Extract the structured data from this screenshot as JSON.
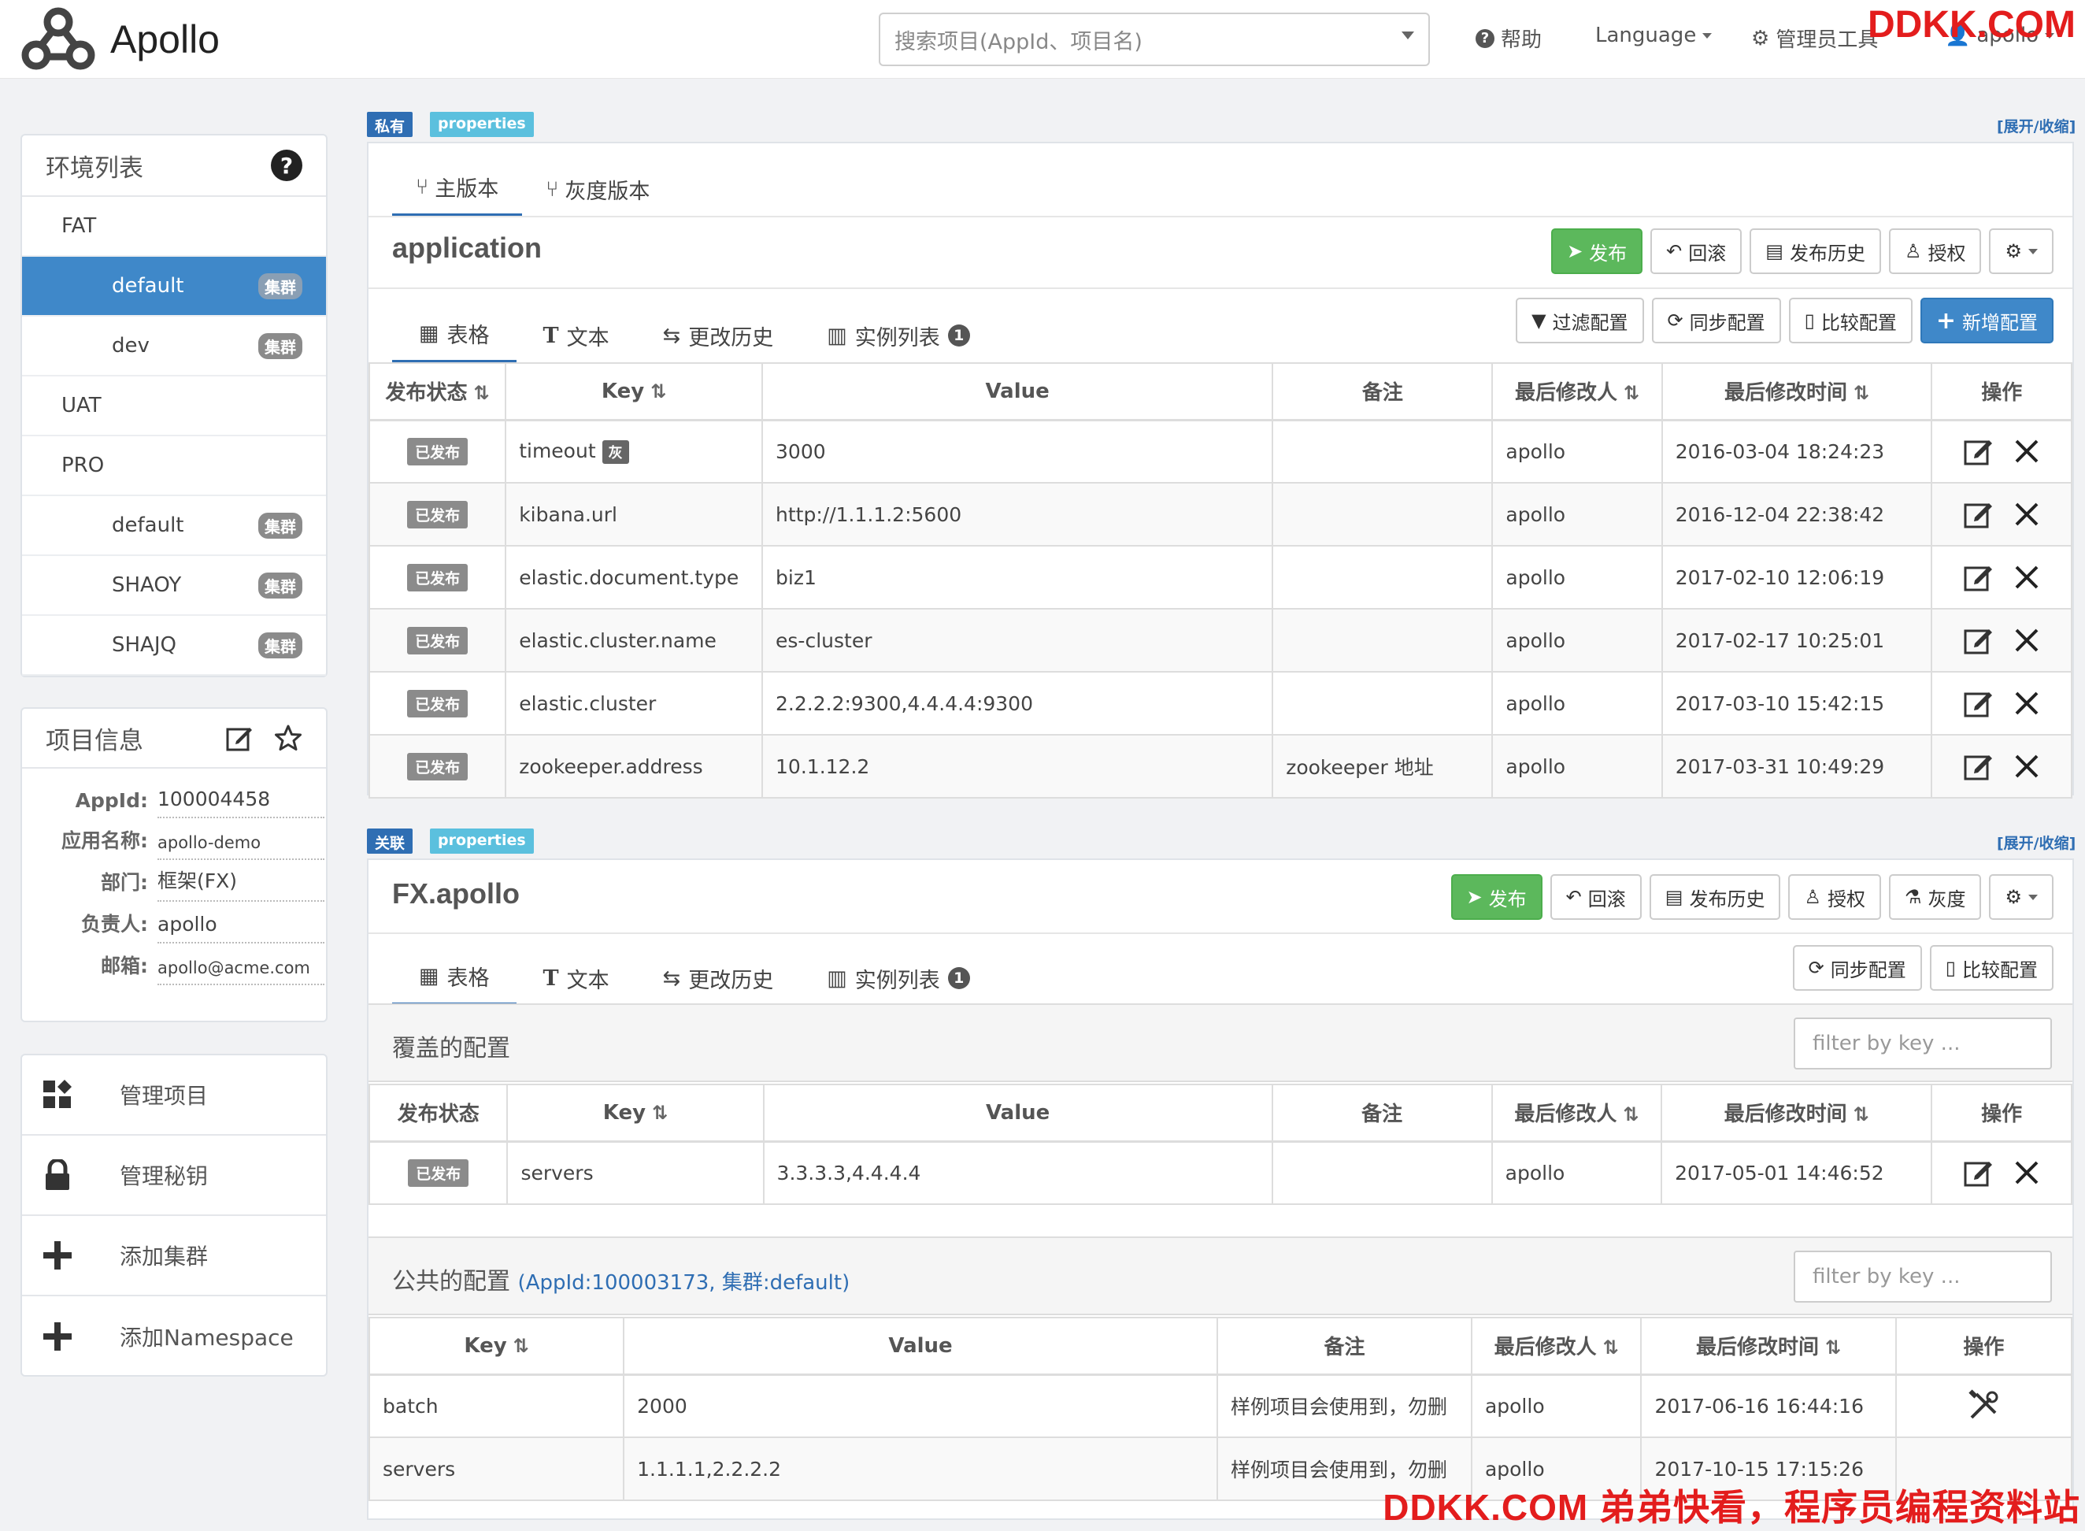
{
  "header": {
    "brand": "Apollo",
    "search_placeholder": "搜索项目(AppId、项目名)",
    "help": "帮助",
    "language": "Language",
    "admin_tools": "管理员工具",
    "user": "apollo",
    "watermark": "DDKK.COM"
  },
  "sidebar": {
    "env_title": "环境列表",
    "envs": [
      {
        "kind": "env",
        "label": "FAT"
      },
      {
        "kind": "cluster",
        "label": "default",
        "badge": "集群",
        "active": true
      },
      {
        "kind": "cluster",
        "label": "dev",
        "badge": "集群"
      },
      {
        "kind": "env",
        "label": "UAT"
      },
      {
        "kind": "env",
        "label": "PRO"
      },
      {
        "kind": "cluster",
        "label": "default",
        "badge": "集群"
      },
      {
        "kind": "cluster",
        "label": "SHAOY",
        "badge": "集群"
      },
      {
        "kind": "cluster",
        "label": "SHAJQ",
        "badge": "集群"
      }
    ],
    "project_info": {
      "title": "项目信息",
      "rows": [
        {
          "label": "AppId:",
          "value": "100004458"
        },
        {
          "label": "应用名称:",
          "value": "apollo-demo"
        },
        {
          "label": "部门:",
          "value": "框架(FX)"
        },
        {
          "label": "负责人:",
          "value": "apollo"
        },
        {
          "label": "邮箱:",
          "value": "apollo@acme.com"
        }
      ]
    },
    "menu": [
      {
        "icon": "grid-icon",
        "label": "管理项目"
      },
      {
        "icon": "lock-icon",
        "label": "管理秘钥"
      },
      {
        "icon": "plus-icon",
        "label": "添加集群"
      },
      {
        "icon": "plus-icon",
        "label": "添加Namespace"
      }
    ]
  },
  "ns1": {
    "tag_scope": "私有",
    "tag_format": "properties",
    "expand": "[展开/收缩]",
    "version_tabs": [
      "主版本",
      "灰度版本"
    ],
    "title": "application",
    "buttons": [
      "发布",
      "回滚",
      "发布历史",
      "授权"
    ],
    "sub_tabs": [
      "表格",
      "文本",
      "更改历史",
      "实例列表"
    ],
    "instance_count": "1",
    "table_buttons": [
      "过滤配置",
      "同步配置",
      "比较配置",
      "新增配置"
    ],
    "columns": [
      "发布状态",
      "Key",
      "Value",
      "备注",
      "最后修改人",
      "最后修改时间",
      "操作"
    ],
    "rows": [
      {
        "status": "已发布",
        "key": "timeout",
        "gray": "灰",
        "value": "3000",
        "comment": "",
        "user": "apollo",
        "time": "2016-03-04 18:24:23"
      },
      {
        "status": "已发布",
        "key": "kibana.url",
        "value": "http://1.1.1.2:5600",
        "comment": "",
        "user": "apollo",
        "time": "2016-12-04 22:38:42"
      },
      {
        "status": "已发布",
        "key": "elastic.document.type",
        "value": "biz1",
        "comment": "",
        "user": "apollo",
        "time": "2017-02-10 12:06:19"
      },
      {
        "status": "已发布",
        "key": "elastic.cluster.name",
        "value": "es-cluster",
        "comment": "",
        "user": "apollo",
        "time": "2017-02-17 10:25:01"
      },
      {
        "status": "已发布",
        "key": "elastic.cluster",
        "value": "2.2.2.2:9300,4.4.4.4:9300",
        "comment": "",
        "user": "apollo",
        "time": "2017-03-10 15:42:15"
      },
      {
        "status": "已发布",
        "key": "zookeeper.address",
        "value": "10.1.12.2",
        "comment": "zookeeper 地址",
        "user": "apollo",
        "time": "2017-03-31 10:49:29"
      }
    ]
  },
  "ns2": {
    "tag_scope": "关联",
    "tag_format": "properties",
    "expand": "[展开/收缩]",
    "title": "FX.apollo",
    "buttons": [
      "发布",
      "回滚",
      "发布历史",
      "授权",
      "灰度"
    ],
    "sub_tabs": [
      "表格",
      "文本",
      "更改历史",
      "实例列表"
    ],
    "instance_count": "1",
    "table_buttons": [
      "同步配置",
      "比较配置"
    ],
    "override_title": "覆盖的配置",
    "filter_placeholder": "filter by key ...",
    "override_columns": [
      "发布状态",
      "Key",
      "Value",
      "备注",
      "最后修改人",
      "最后修改时间",
      "操作"
    ],
    "override_rows": [
      {
        "status": "已发布",
        "key": "servers",
        "value": "3.3.3.3,4.4.4.4",
        "comment": "",
        "user": "apollo",
        "time": "2017-05-01 14:46:52"
      }
    ],
    "public_title": "公共的配置",
    "public_sub": "(AppId:100003173, 集群:default)",
    "public_columns": [
      "Key",
      "Value",
      "备注",
      "最后修改人",
      "最后修改时间",
      "操作"
    ],
    "public_rows": [
      {
        "key": "batch",
        "value": "2000",
        "comment": "样例项目会使用到，勿删",
        "user": "apollo",
        "time": "2017-06-16 16:44:16",
        "op": true
      },
      {
        "key": "servers",
        "value": "1.1.1.1,2.2.2.2",
        "comment": "样例项目会使用到，勿删",
        "user": "apollo",
        "time": "2017-10-15 17:15:26",
        "op": false
      }
    ]
  },
  "footer_watermark": "DDKK.COM 弟弟快看，程序员编程资料站"
}
